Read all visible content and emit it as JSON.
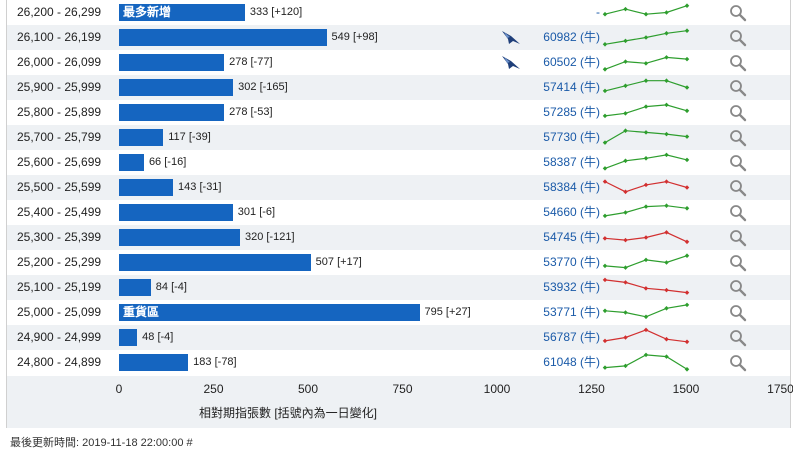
{
  "rows": [
    {
      "range": "26,200 - 26,299",
      "value": 333,
      "change": "[+120]",
      "label": "最多新增",
      "ticker": "-",
      "bird": false,
      "spark_color": "#2e9e2e",
      "spark": [
        0.4,
        0.7,
        0.4,
        0.5,
        0.9
      ]
    },
    {
      "range": "26,100 - 26,199",
      "value": 549,
      "change": "[+98]",
      "label": "",
      "ticker": "60982 (牛)",
      "bird": true,
      "spark_color": "#2e9e2e",
      "spark": [
        0.1,
        0.3,
        0.5,
        0.75,
        0.9
      ]
    },
    {
      "range": "26,000 - 26,099",
      "value": 278,
      "change": "[-77]",
      "label": "",
      "ticker": "60502 (牛)",
      "bird": true,
      "spark_color": "#2e9e2e",
      "spark": [
        0.1,
        0.55,
        0.45,
        0.8,
        0.7
      ]
    },
    {
      "range": "25,900 - 25,999",
      "value": 302,
      "change": "[-165]",
      "label": "",
      "ticker": "57414 (牛)",
      "bird": false,
      "spark_color": "#2e9e2e",
      "spark": [
        0.3,
        0.6,
        0.9,
        0.9,
        0.5
      ]
    },
    {
      "range": "25,800 - 25,899",
      "value": 278,
      "change": "[-53]",
      "label": "",
      "ticker": "57285 (牛)",
      "bird": false,
      "spark_color": "#2e9e2e",
      "spark": [
        0.3,
        0.45,
        0.85,
        0.95,
        0.6
      ]
    },
    {
      "range": "25,700 - 25,799",
      "value": 117,
      "change": "[-39]",
      "label": "",
      "ticker": "57730 (牛)",
      "bird": false,
      "spark_color": "#2e9e2e",
      "spark": [
        0.2,
        0.9,
        0.8,
        0.7,
        0.55
      ]
    },
    {
      "range": "25,600 - 25,699",
      "value": 66,
      "change": "[-16]",
      "label": "",
      "ticker": "58387 (牛)",
      "bird": false,
      "spark_color": "#2e9e2e",
      "spark": [
        0.15,
        0.6,
        0.75,
        0.95,
        0.65
      ]
    },
    {
      "range": "25,500 - 25,599",
      "value": 143,
      "change": "[-31]",
      "label": "",
      "ticker": "58384 (牛)",
      "bird": false,
      "spark_color": "#d23030",
      "spark": [
        0.85,
        0.25,
        0.65,
        0.85,
        0.5
      ]
    },
    {
      "range": "25,400 - 25,499",
      "value": 301,
      "change": "[-6]",
      "label": "",
      "ticker": "54660 (牛)",
      "bird": false,
      "spark_color": "#2e9e2e",
      "spark": [
        0.3,
        0.5,
        0.85,
        0.9,
        0.75
      ]
    },
    {
      "range": "25,300 - 25,399",
      "value": 320,
      "change": "[-121]",
      "label": "",
      "ticker": "54745 (牛)",
      "bird": false,
      "spark_color": "#d23030",
      "spark": [
        0.45,
        0.35,
        0.5,
        0.8,
        0.25
      ]
    },
    {
      "range": "25,200 - 25,299",
      "value": 507,
      "change": "[+17]",
      "label": "",
      "ticker": "53770 (牛)",
      "bird": false,
      "spark_color": "#2e9e2e",
      "spark": [
        0.3,
        0.2,
        0.65,
        0.5,
        0.9
      ]
    },
    {
      "range": "25,100 - 25,199",
      "value": 84,
      "change": "[-4]",
      "label": "",
      "ticker": "53932 (牛)",
      "bird": false,
      "spark_color": "#d23030",
      "spark": [
        0.95,
        0.8,
        0.45,
        0.35,
        0.2
      ]
    },
    {
      "range": "25,000 - 25,099",
      "value": 795,
      "change": "[+27]",
      "label": "重貨區",
      "ticker": "53771 (牛)",
      "bird": false,
      "spark_color": "#2e9e2e",
      "spark": [
        0.6,
        0.5,
        0.25,
        0.75,
        0.95
      ]
    },
    {
      "range": "24,900 - 24,999",
      "value": 48,
      "change": "[-4]",
      "label": "",
      "ticker": "56787 (牛)",
      "bird": false,
      "spark_color": "#d23030",
      "spark": [
        0.3,
        0.5,
        0.95,
        0.4,
        0.25
      ]
    },
    {
      "range": "24,800 - 24,899",
      "value": 183,
      "change": "[-78]",
      "label": "",
      "ticker": "61048 (牛)",
      "bird": false,
      "spark_color": "#2e9e2e",
      "spark": [
        0.2,
        0.3,
        0.95,
        0.85,
        0.1
      ]
    }
  ],
  "chart_data": {
    "type": "bar",
    "orientation": "horizontal",
    "categories": [
      "26,200 - 26,299",
      "26,100 - 26,199",
      "26,000 - 26,099",
      "25,900 - 25,999",
      "25,800 - 25,899",
      "25,700 - 25,799",
      "25,600 - 25,699",
      "25,500 - 25,599",
      "25,400 - 25,499",
      "25,300 - 25,399",
      "25,200 - 25,299",
      "25,100 - 25,199",
      "25,000 - 25,099",
      "24,900 - 24,999",
      "24,800 - 24,899"
    ],
    "values": [
      333,
      549,
      278,
      302,
      278,
      117,
      66,
      143,
      301,
      320,
      507,
      84,
      795,
      48,
      183
    ],
    "changes": [
      "[+120]",
      "[+98]",
      "[-77]",
      "[-165]",
      "[-53]",
      "[-39]",
      "[-16]",
      "[-31]",
      "[-6]",
      "[-121]",
      "[+17]",
      "[-4]",
      "[+27]",
      "[-4]",
      "[-78]"
    ],
    "xlabel": "相對期指張數 [括號內為一日變化]",
    "xlim": [
      0,
      1750
    ],
    "xticks": [
      0,
      250,
      500,
      750,
      1000,
      1250,
      1500,
      1750
    ],
    "bar_color": "#1565c0"
  },
  "footer": {
    "updated": "最後更新時間: 2019-11-18 22:00:00 #"
  },
  "colors": {
    "row_alt": "#eef1f4",
    "link": "#1a5aa8",
    "spark_up": "#2e9e2e",
    "spark_down": "#d23030"
  },
  "icons": {
    "row_action": "magnifier-icon",
    "issuer": "bird-logo-icon"
  }
}
